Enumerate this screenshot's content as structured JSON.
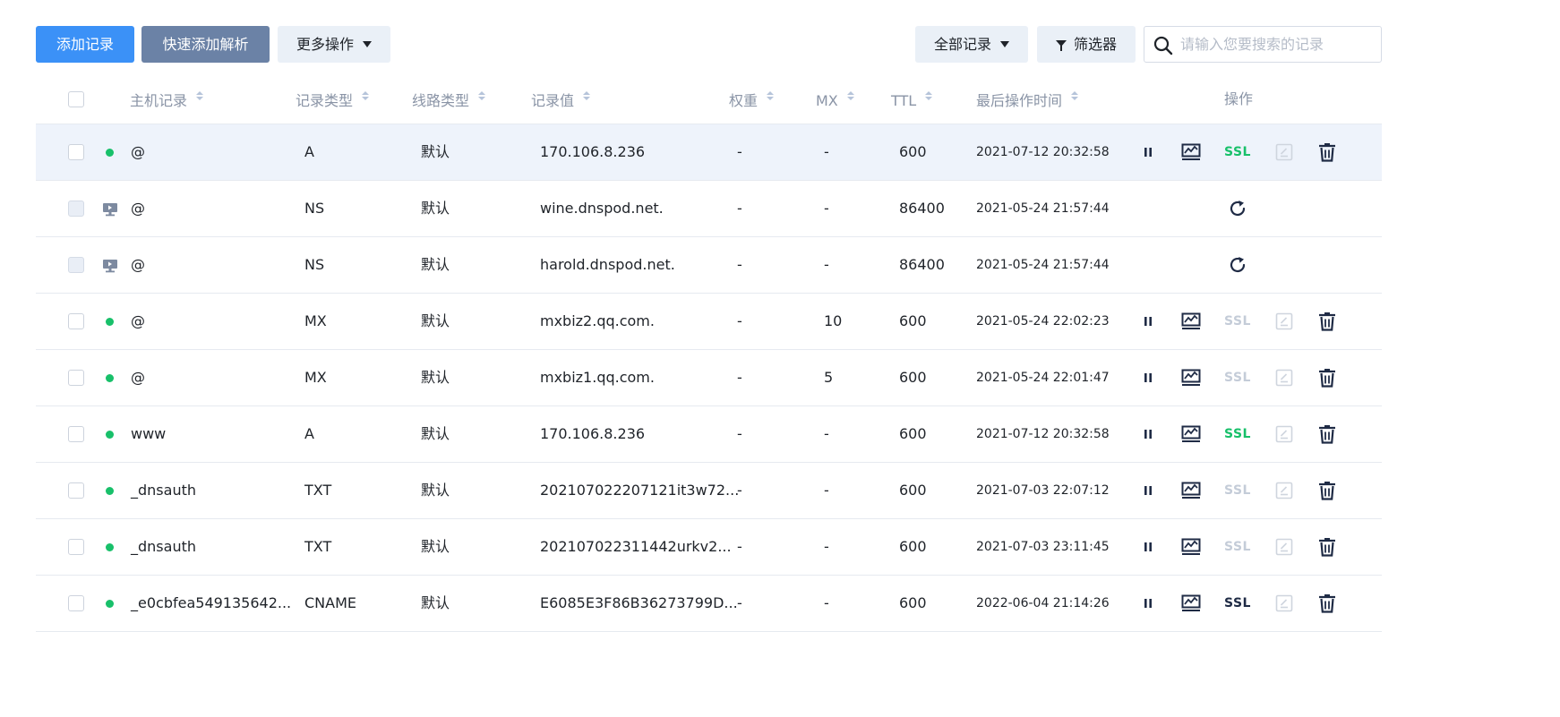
{
  "toolbar": {
    "add_record": "添加记录",
    "quick_add": "快速添加解析",
    "more_actions": "更多操作",
    "all_records": "全部记录",
    "filter": "筛选器",
    "search_placeholder": "请输入您要搜索的记录"
  },
  "columns": {
    "host": "主机记录",
    "type": "记录类型",
    "line": "线路类型",
    "value": "记录值",
    "weight": "权重",
    "mx": "MX",
    "ttl": "TTL",
    "time": "最后操作时间",
    "actions": "操作"
  },
  "colors": {
    "primary": "#3b91f7",
    "secondary_button": "#6b82a6",
    "status_enabled": "#18c06a",
    "ssl_active": "#18c06a",
    "ssl_disabled": "#c4ccd8",
    "row_highlight": "#eef3fb"
  },
  "records": [
    {
      "host": "@",
      "type": "A",
      "line": "默认",
      "value": "170.106.8.236",
      "weight": "-",
      "mx": "-",
      "ttl": "600",
      "time": "2021-07-12 20:32:58",
      "ssl": "SSL",
      "ssl_state": "active",
      "system": false,
      "highlighted": true
    },
    {
      "host": "@",
      "type": "NS",
      "line": "默认",
      "value": "wine.dnspod.net.",
      "weight": "-",
      "mx": "-",
      "ttl": "86400",
      "time": "2021-05-24 21:57:44",
      "ssl": "",
      "ssl_state": "none",
      "system": true,
      "highlighted": false
    },
    {
      "host": "@",
      "type": "NS",
      "line": "默认",
      "value": "harold.dnspod.net.",
      "weight": "-",
      "mx": "-",
      "ttl": "86400",
      "time": "2021-05-24 21:57:44",
      "ssl": "",
      "ssl_state": "none",
      "system": true,
      "highlighted": false
    },
    {
      "host": "@",
      "type": "MX",
      "line": "默认",
      "value": "mxbiz2.qq.com.",
      "weight": "-",
      "mx": "10",
      "ttl": "600",
      "time": "2021-05-24 22:02:23",
      "ssl": "SSL",
      "ssl_state": "disabled",
      "system": false,
      "highlighted": false
    },
    {
      "host": "@",
      "type": "MX",
      "line": "默认",
      "value": "mxbiz1.qq.com.",
      "weight": "-",
      "mx": "5",
      "ttl": "600",
      "time": "2021-05-24 22:01:47",
      "ssl": "SSL",
      "ssl_state": "disabled",
      "system": false,
      "highlighted": false
    },
    {
      "host": "www",
      "type": "A",
      "line": "默认",
      "value": "170.106.8.236",
      "weight": "-",
      "mx": "-",
      "ttl": "600",
      "time": "2021-07-12 20:32:58",
      "ssl": "SSL",
      "ssl_state": "active",
      "system": false,
      "highlighted": false
    },
    {
      "host": "_dnsauth",
      "type": "TXT",
      "line": "默认",
      "value": "202107022207121it3w72...",
      "weight": "-",
      "mx": "-",
      "ttl": "600",
      "time": "2021-07-03 22:07:12",
      "ssl": "SSL",
      "ssl_state": "disabled",
      "system": false,
      "highlighted": false
    },
    {
      "host": "_dnsauth",
      "type": "TXT",
      "line": "默认",
      "value": "202107022311442urkv2...",
      "weight": "-",
      "mx": "-",
      "ttl": "600",
      "time": "2021-07-03 23:11:45",
      "ssl": "SSL",
      "ssl_state": "disabled",
      "system": false,
      "highlighted": false
    },
    {
      "host": "_e0cbfea549135642...",
      "type": "CNAME",
      "line": "默认",
      "value": "E6085E3F86B36273799D...",
      "weight": "-",
      "mx": "-",
      "ttl": "600",
      "time": "2022-06-04 21:14:26",
      "ssl": "SSL",
      "ssl_state": "dark",
      "system": false,
      "highlighted": false
    }
  ]
}
